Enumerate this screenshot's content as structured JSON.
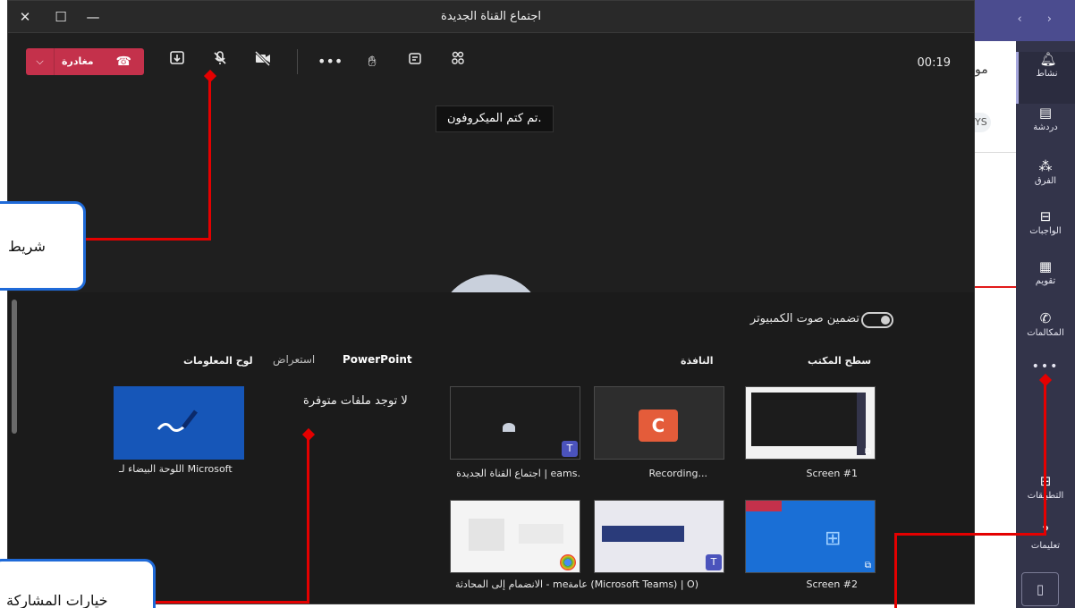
{
  "window": {
    "title": "اجتماع القناة الجديدة",
    "close": "✕",
    "maximize": "☐",
    "minimize": "—"
  },
  "toolbar": {
    "leave_label": "مغادرة",
    "leave_chevron": "⌵",
    "phone": "☎",
    "timer": "00:19",
    "icons": [
      "share-tray-icon",
      "mic-muted-icon",
      "camera-off-icon",
      "more-icon",
      "raise-hand-icon",
      "chat-icon",
      "participants-icon"
    ]
  },
  "toast": "تم كتم الميكروفون.",
  "tray": {
    "toggle_label": "تضمين صوت الكمبيوتر",
    "sections": {
      "desktop": "سطح المكتب",
      "window": "النافذة",
      "powerpoint": "PowerPoint",
      "browse": "استعراض",
      "whiteboard": "لوح المعلومات"
    },
    "no_files": "لا توجد ملفات متوفرة",
    "thumbs": [
      {
        "caption": "Screen #1"
      },
      {
        "caption": "Recording..."
      },
      {
        "caption": "اجتماع القناة الجديدة | eams."
      },
      {
        "caption": "Screen #2"
      },
      {
        "caption": "عامة (Microsoft Teams) | O)"
      },
      {
        "caption": "الانضمام إلى المحادثة - me."
      }
    ],
    "whiteboard_caption": "اللوحة البيضاء لـ Microsoft"
  },
  "teams": {
    "rail": [
      {
        "label": "نشاط",
        "icon": "bell-icon"
      },
      {
        "label": "دردشة",
        "icon": "chat-icon"
      },
      {
        "label": "الفرق",
        "icon": "teams-icon"
      },
      {
        "label": "الواجبات",
        "icon": "backpack-icon"
      },
      {
        "label": "تقويم",
        "icon": "calendar-icon"
      },
      {
        "label": "المكالمات",
        "icon": "phone-icon"
      }
    ],
    "more": "•••",
    "apps_label": "التطبيقات",
    "help_label": "تعليمات",
    "peek_text": "مو",
    "peek_badge": "YS"
  },
  "callouts": {
    "toolbar": "شريط",
    "sharing": "خيارات المشاركة"
  }
}
